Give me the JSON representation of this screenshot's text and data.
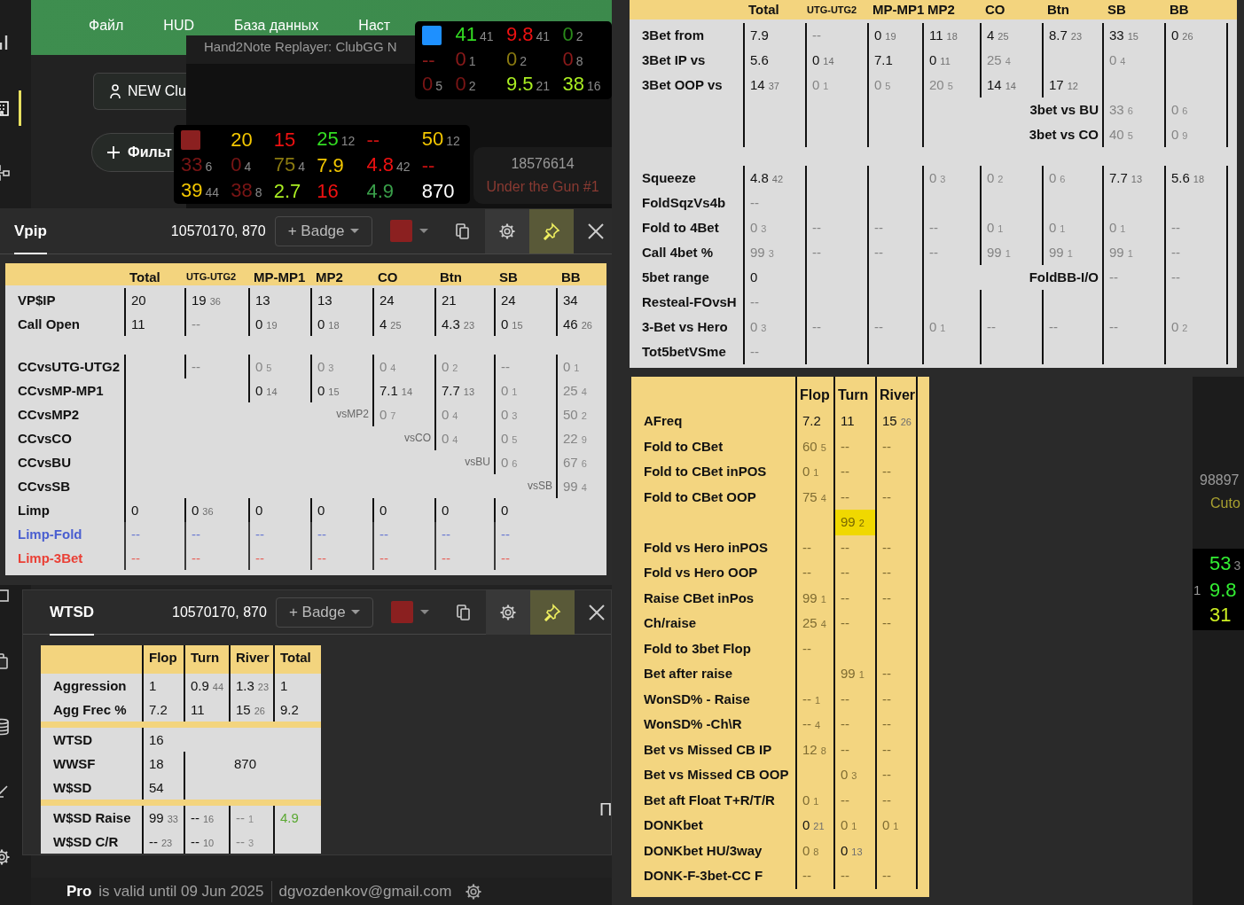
{
  "sidebar": {
    "items": [
      {
        "selected": false
      },
      {
        "selected": true
      },
      {
        "selected": false
      },
      {
        "selected": false
      },
      {
        "selected": false
      },
      {
        "selected": false
      },
      {
        "selected": false
      },
      {
        "selected": false
      }
    ]
  },
  "app_menu": [
    "Файл",
    "HUD",
    "База данных",
    "Наст"
  ],
  "toolbar": {
    "client_button": "NEW Clu",
    "filter_button": "Фильт"
  },
  "replayer": {
    "title": "Hand2Note Replayer: ClubGG N"
  },
  "huds": [
    {
      "rows": [
        [
          {
            "kind": "swatch",
            "color": "#1e90ff"
          },
          {
            "kind": "stat",
            "value": "41",
            "count": "41",
            "color": "#33dd22"
          },
          {
            "kind": "stat",
            "value": "9.8",
            "count": "41",
            "color": "#ee1111"
          },
          {
            "kind": "stat",
            "value": "0",
            "count": "2",
            "color": "#2a8a1a"
          }
        ],
        [
          {
            "kind": "stat",
            "value": "--",
            "color": "#8b1a1a"
          },
          {
            "kind": "stat",
            "value": "0",
            "count": "1",
            "color": "#8b1a1a"
          },
          {
            "kind": "stat",
            "value": "0",
            "count": "2",
            "color": "#8a7a10"
          },
          {
            "kind": "stat",
            "value": "0",
            "count": "8",
            "color": "#8b1a1a"
          }
        ],
        [
          {
            "kind": "stat",
            "value": "0",
            "count": "5",
            "color": "#7a1515"
          },
          {
            "kind": "stat",
            "value": "0",
            "count": "2",
            "color": "#7a1515"
          },
          {
            "kind": "stat",
            "value": "9.5",
            "count": "21",
            "color": "#aaee22"
          },
          {
            "kind": "stat",
            "value": "38",
            "count": "16",
            "color": "#aaee22"
          }
        ]
      ]
    },
    {
      "rows": [
        [
          {
            "kind": "swatch",
            "color": "#8b2020"
          },
          {
            "kind": "stat",
            "value": "20",
            "color": "#f5c800"
          },
          {
            "kind": "stat",
            "value": "15",
            "color": "#ee1111"
          },
          {
            "kind": "stat",
            "value": "25",
            "count": "12",
            "color": "#33dd22"
          },
          {
            "kind": "stat",
            "value": "--",
            "color": "#cc1111"
          },
          {
            "kind": "stat",
            "value": "50",
            "count": "12",
            "color": "#f5c800"
          }
        ],
        [
          {
            "kind": "stat",
            "value": "33",
            "count": "6",
            "color": "#7a1515"
          },
          {
            "kind": "stat",
            "value": "0",
            "count": "4",
            "color": "#7a1515"
          },
          {
            "kind": "stat",
            "value": "75",
            "count": "4",
            "color": "#8a7a10"
          },
          {
            "kind": "stat",
            "value": "7.9",
            "color": "#f5c800"
          },
          {
            "kind": "stat",
            "value": "4.8",
            "count": "42",
            "color": "#ee1111"
          },
          {
            "kind": "stat",
            "value": "--",
            "color": "#cc1111"
          }
        ],
        [
          {
            "kind": "stat",
            "value": "39",
            "count": "44",
            "color": "#f5c800"
          },
          {
            "kind": "stat",
            "value": "38",
            "count": "8",
            "color": "#7a1515"
          },
          {
            "kind": "stat",
            "value": "2.7",
            "color": "#aaee22"
          },
          {
            "kind": "stat",
            "value": "16",
            "color": "#ee1111"
          },
          {
            "kind": "stat",
            "value": "4.9",
            "color": "#3aa04a"
          },
          {
            "kind": "stat",
            "value": "870",
            "color": "#ffffff"
          }
        ]
      ]
    }
  ],
  "player": {
    "id": "18576614",
    "position": "Under the Gun #1"
  },
  "vpip_popup": {
    "tab": {
      "label": "Vpip",
      "selected": true
    },
    "player_ids": "10570170, 870",
    "badge_button": "+ Badge",
    "color": "#8b2020",
    "pinned": true,
    "table": {
      "columns": [
        "Total",
        "UTG-UTG2",
        "MP-MP1",
        "MP2",
        "CO",
        "Btn",
        "SB",
        "BB"
      ],
      "rows": [
        {
          "kind": "stat",
          "label": "VP$IP",
          "cells": [
            {
              "value": "20"
            },
            {
              "value": "19",
              "count": "36"
            },
            {
              "value": "13"
            },
            {
              "value": "13"
            },
            {
              "value": "24"
            },
            {
              "value": "21"
            },
            {
              "value": "24"
            },
            {
              "value": "34"
            }
          ]
        },
        {
          "kind": "stat",
          "label": "Call Open",
          "cells": [
            {
              "value": "11"
            },
            {
              "value": "--",
              "faded": true
            },
            {
              "value": "0",
              "count": "19"
            },
            {
              "value": "0",
              "count": "18"
            },
            {
              "value": "4",
              "count": "25"
            },
            {
              "value": "4.3",
              "count": "23"
            },
            {
              "value": "0",
              "count": "15"
            },
            {
              "value": "46",
              "count": "26"
            }
          ]
        },
        {
          "kind": "spacer"
        },
        {
          "kind": "stat",
          "label": "CCvsUTG-UTG2",
          "cells": [
            {
              "kind": "blank"
            },
            {
              "value": "--",
              "faded": true
            },
            {
              "value": "0",
              "count": "5",
              "faded": true
            },
            {
              "value": "0",
              "count": "3",
              "faded": true
            },
            {
              "value": "0",
              "count": "4",
              "faded": true
            },
            {
              "value": "0",
              "count": "2",
              "faded": true
            },
            {
              "value": "--",
              "faded": true
            },
            {
              "value": "0",
              "count": "1",
              "faded": true
            }
          ]
        },
        {
          "kind": "stat",
          "label": "CCvsMP-MP1",
          "cells": [
            {
              "kind": "blank"
            },
            null,
            {
              "value": "0",
              "count": "14"
            },
            {
              "value": "0",
              "count": "15"
            },
            {
              "value": "7.1",
              "count": "14"
            },
            {
              "value": "7.7",
              "count": "13"
            },
            {
              "value": "0",
              "count": "1",
              "faded": true
            },
            {
              "value": "25",
              "count": "4",
              "faded": true
            }
          ]
        },
        {
          "kind": "stat",
          "label": "CCvsMP2",
          "cells": [
            {
              "kind": "blank"
            },
            null,
            null,
            {
              "kind": "note",
              "value": "vsMP2"
            },
            {
              "value": "0",
              "count": "7",
              "faded": true
            },
            {
              "value": "0",
              "count": "4",
              "faded": true
            },
            {
              "value": "0",
              "count": "3",
              "faded": true
            },
            {
              "value": "50",
              "count": "2",
              "faded": true
            }
          ]
        },
        {
          "kind": "stat",
          "label": "CCvsCO",
          "cells": [
            {
              "kind": "blank"
            },
            null,
            null,
            null,
            {
              "kind": "note",
              "value": "vsCO"
            },
            {
              "value": "0",
              "count": "4",
              "faded": true
            },
            {
              "value": "0",
              "count": "5",
              "faded": true
            },
            {
              "value": "22",
              "count": "9",
              "faded": true
            }
          ]
        },
        {
          "kind": "stat",
          "label": "CCvsBU",
          "cells": [
            {
              "kind": "blank"
            },
            null,
            null,
            null,
            null,
            {
              "kind": "note",
              "value": "vsBU"
            },
            {
              "value": "0",
              "count": "6",
              "faded": true
            },
            {
              "value": "67",
              "count": "6",
              "faded": true
            }
          ]
        },
        {
          "kind": "stat",
          "label": "CCvsSB",
          "cells": [
            {
              "kind": "blank"
            },
            null,
            null,
            null,
            null,
            null,
            {
              "kind": "note",
              "value": "vsSB"
            },
            {
              "value": "99",
              "count": "4",
              "faded": true
            }
          ]
        },
        {
          "kind": "stat",
          "label": "Limp",
          "cells": [
            {
              "value": "0"
            },
            {
              "value": "0",
              "count": "36"
            },
            {
              "value": "0"
            },
            {
              "value": "0"
            },
            {
              "value": "0"
            },
            {
              "value": "0"
            },
            {
              "value": "0"
            },
            null
          ]
        },
        {
          "kind": "stat",
          "label": "Limp-Fold",
          "color": "#4a5fd0",
          "cells": [
            {
              "value": "--",
              "faded": true
            },
            {
              "value": "--",
              "faded": true
            },
            {
              "value": "--",
              "faded": true
            },
            {
              "value": "--",
              "faded": true
            },
            {
              "value": "--",
              "faded": true
            },
            {
              "value": "--",
              "faded": true
            },
            {
              "value": "--",
              "faded": true
            },
            null
          ]
        },
        {
          "kind": "stat",
          "label": "Limp-3Bet",
          "color": "#ea4036",
          "cells": [
            {
              "value": "--",
              "faded": true
            },
            {
              "value": "--",
              "faded": true
            },
            {
              "value": "--",
              "faded": true
            },
            {
              "value": "--",
              "faded": true
            },
            {
              "value": "--",
              "faded": true
            },
            {
              "value": "--",
              "faded": true
            },
            {
              "value": "--",
              "faded": true
            },
            null
          ]
        }
      ]
    }
  },
  "wtsd_popup": {
    "tab": {
      "label": "WTSD",
      "selected": true
    },
    "player_ids": "10570170, 870",
    "badge_button": "+ Badge",
    "color": "#8b2020",
    "pinned": true,
    "table": {
      "columns": [
        "Flop",
        "Turn",
        "River",
        "Total"
      ],
      "rows": [
        {
          "kind": "stat",
          "label": "Aggression",
          "cells": [
            {
              "value": "1"
            },
            {
              "value": "0.9",
              "count": "44"
            },
            {
              "value": "1.3",
              "count": "23"
            },
            {
              "value": "1"
            }
          ]
        },
        {
          "kind": "stat",
          "label": "Agg Frec %",
          "cells": [
            {
              "value": "7.2"
            },
            {
              "value": "11"
            },
            {
              "value": "15",
              "count": "26"
            },
            {
              "value": "9.2"
            }
          ]
        },
        {
          "kind": "divider"
        },
        {
          "kind": "stat",
          "label": "WTSD",
          "cells": [
            {
              "value": "16"
            },
            null,
            null,
            null
          ]
        },
        {
          "kind": "stat",
          "label": "WWSF",
          "cells": [
            {
              "value": "18"
            },
            {
              "kind": "blank"
            },
            {
              "kind": "free",
              "value": "870"
            },
            null
          ]
        },
        {
          "kind": "stat",
          "label": "W$SD",
          "cells": [
            {
              "value": "54"
            },
            {
              "kind": "blank"
            },
            null,
            null
          ]
        },
        {
          "kind": "divider"
        },
        {
          "kind": "stat",
          "label": "W$SD Raise",
          "cells": [
            {
              "value": "99",
              "count": "33"
            },
            {
              "value": "--",
              "count": "16"
            },
            {
              "value": "--",
              "count": "1",
              "faded": true
            },
            {
              "value": "4.9",
              "color": "#5aa832"
            }
          ]
        },
        {
          "kind": "stat",
          "label": "W$SD C/R",
          "cells": [
            {
              "value": "--",
              "count": "23"
            },
            {
              "value": "--",
              "count": "10"
            },
            {
              "value": "--",
              "count": "3",
              "faded": true
            },
            {
              "kind": "blank"
            }
          ]
        }
      ]
    }
  },
  "footer": {
    "plan": "Pro",
    "validity": "is valid until 09 Jun 2025",
    "email": "dgvozdenkov@gmail.com"
  },
  "cut_glyph": "П",
  "preflop_table": {
    "columns": [
      "Total",
      "UTG-UTG2",
      "MP-MP1",
      "MP2",
      "CO",
      "Btn",
      "SB",
      "BB"
    ],
    "rows": [
      {
        "kind": "stat",
        "label": "3Bet from",
        "cells": [
          {
            "value": "7.9"
          },
          {
            "value": "--",
            "faded": true
          },
          {
            "value": "0",
            "count": "19"
          },
          {
            "value": "11",
            "count": "18"
          },
          {
            "value": "4",
            "count": "25"
          },
          {
            "value": "8.7",
            "count": "23"
          },
          {
            "value": "33",
            "count": "15"
          },
          {
            "value": "0",
            "count": "26"
          }
        ]
      },
      {
        "kind": "stat",
        "label": "3Bet IP vs",
        "cells": [
          {
            "value": "5.6"
          },
          {
            "value": "0",
            "count": "14"
          },
          {
            "value": "7.1"
          },
          {
            "value": "0",
            "count": "11"
          },
          {
            "value": "25",
            "count": "4",
            "faded": true
          },
          {
            "kind": "blank"
          },
          {
            "value": "0",
            "count": "4",
            "faded": true
          },
          {
            "kind": "blank"
          }
        ]
      },
      {
        "kind": "stat",
        "label": "3Bet OOP vs",
        "cells": [
          {
            "value": "14",
            "count": "37"
          },
          {
            "value": "0",
            "count": "1",
            "faded": true
          },
          {
            "value": "0",
            "count": "5",
            "faded": true
          },
          {
            "value": "20",
            "count": "5",
            "faded": true
          },
          {
            "value": "14",
            "count": "14"
          },
          {
            "value": "17",
            "count": "12"
          },
          {
            "kind": "blank"
          },
          {
            "kind": "blank"
          }
        ]
      },
      {
        "kind": "stat",
        "cells": [
          {
            "kind": "blank"
          },
          {
            "kind": "blank"
          },
          {
            "kind": "blank"
          },
          {
            "kind": "blank"
          },
          {
            "kind": "wide-label",
            "value": "3bet vs BU"
          },
          {
            "value": "33",
            "count": "6",
            "faded": true
          },
          {
            "value": "0",
            "count": "6",
            "faded": true
          }
        ]
      },
      {
        "kind": "stat",
        "cells": [
          {
            "kind": "blank"
          },
          {
            "kind": "blank"
          },
          {
            "kind": "blank"
          },
          {
            "kind": "blank"
          },
          {
            "kind": "wide-label",
            "value": "3bet vs CO"
          },
          {
            "value": "40",
            "count": "5",
            "faded": true
          },
          {
            "value": "0",
            "count": "9",
            "faded": true
          }
        ]
      },
      {
        "kind": "spacer"
      },
      {
        "kind": "stat",
        "label": "Squeeze",
        "cells": [
          {
            "value": "4.8",
            "count": "42"
          },
          {
            "kind": "blank"
          },
          {
            "kind": "blank"
          },
          {
            "value": "0",
            "count": "3",
            "faded": true
          },
          {
            "value": "0",
            "count": "2",
            "faded": true
          },
          {
            "value": "0",
            "count": "6",
            "faded": true
          },
          {
            "value": "7.7",
            "count": "13"
          },
          {
            "value": "5.6",
            "count": "18"
          }
        ]
      },
      {
        "kind": "stat",
        "label": "FoldSqzVs4b",
        "cells": [
          {
            "value": "--",
            "faded": true
          },
          {
            "kind": "blank"
          },
          {
            "kind": "blank"
          },
          {
            "kind": "blank"
          },
          {
            "kind": "blank"
          },
          {
            "kind": "blank"
          },
          {
            "kind": "blank"
          },
          {
            "kind": "blank"
          }
        ]
      },
      {
        "kind": "stat",
        "label": "Fold to 4Bet",
        "cells": [
          {
            "value": "0",
            "count": "3",
            "faded": true
          },
          {
            "value": "--",
            "faded": true
          },
          {
            "value": "--",
            "faded": true
          },
          {
            "value": "--",
            "faded": true
          },
          {
            "value": "0",
            "count": "1",
            "faded": true
          },
          {
            "value": "0",
            "count": "1",
            "faded": true
          },
          {
            "value": "0",
            "count": "1",
            "faded": true
          },
          {
            "value": "--",
            "faded": true
          }
        ]
      },
      {
        "kind": "stat",
        "label": "Call 4bet %",
        "cells": [
          {
            "value": "99",
            "count": "3",
            "faded": true
          },
          {
            "value": "--",
            "faded": true
          },
          {
            "value": "--",
            "faded": true
          },
          {
            "value": "--",
            "faded": true
          },
          {
            "value": "99",
            "count": "1",
            "faded": true
          },
          {
            "value": "99",
            "count": "1",
            "faded": true
          },
          {
            "value": "99",
            "count": "1",
            "faded": true
          },
          {
            "value": "--",
            "faded": true
          }
        ]
      },
      {
        "kind": "stat",
        "label": "5bet range",
        "cells": [
          {
            "value": "0"
          },
          {
            "kind": "blank"
          },
          {
            "kind": "blank"
          },
          {
            "kind": "blank"
          },
          {
            "kind": "wide-label",
            "value": "FoldBB-I/O"
          },
          {
            "value": "--",
            "faded": true
          },
          {
            "value": "--",
            "faded": true
          }
        ]
      },
      {
        "kind": "stat",
        "label": "Resteal-FOvsH",
        "cells": [
          {
            "value": "--",
            "faded": true
          },
          {
            "kind": "blank"
          },
          {
            "kind": "blank"
          },
          {
            "kind": "blank"
          },
          {
            "kind": "blank"
          },
          {
            "kind": "blank"
          },
          {
            "kind": "blank"
          },
          {
            "kind": "blank"
          }
        ]
      },
      {
        "kind": "stat",
        "label": "3-Bet vs Hero",
        "cells": [
          {
            "value": "0",
            "count": "3",
            "faded": true
          },
          {
            "value": "--",
            "faded": true
          },
          {
            "value": "--",
            "faded": true
          },
          {
            "value": "0",
            "count": "1",
            "faded": true
          },
          {
            "value": "--",
            "faded": true
          },
          {
            "value": "--",
            "faded": true
          },
          {
            "value": "--",
            "faded": true
          },
          {
            "value": "0",
            "count": "2",
            "faded": true
          }
        ]
      },
      {
        "kind": "stat",
        "label": "Tot5betVSme",
        "cells": [
          {
            "value": "--",
            "faded": true
          },
          {
            "kind": "blank"
          },
          {
            "kind": "blank"
          },
          {
            "kind": "blank"
          },
          {
            "kind": "blank"
          },
          {
            "kind": "blank"
          },
          {
            "kind": "blank"
          },
          {
            "kind": "blank"
          }
        ]
      }
    ]
  },
  "postflop_table": {
    "columns": [
      "Flop",
      "Turn",
      "River"
    ],
    "rows": [
      {
        "kind": "stat",
        "label": "AFreq",
        "cells": [
          {
            "value": "7.2"
          },
          {
            "value": "11"
          },
          {
            "value": "15",
            "count": "26"
          }
        ]
      },
      {
        "kind": "stat",
        "label": "Fold to CBet",
        "cells": [
          {
            "value": "60",
            "count": "5",
            "faded": true
          },
          {
            "value": "--",
            "faded": true
          },
          {
            "value": "--",
            "faded": true
          }
        ]
      },
      {
        "kind": "stat",
        "label": "Fold to CBet inPOS",
        "cells": [
          {
            "value": "0",
            "count": "1",
            "faded": true
          },
          {
            "value": "--",
            "faded": true
          },
          {
            "value": "--",
            "faded": true
          }
        ]
      },
      {
        "kind": "stat",
        "label": "Fold to CBet OOP",
        "cells": [
          {
            "value": "75",
            "count": "4",
            "faded": true
          },
          {
            "value": "--",
            "faded": true
          },
          {
            "value": "--",
            "faded": true
          }
        ]
      },
      {
        "kind": "stat",
        "cells": [
          {
            "kind": "blank"
          },
          {
            "value": "99",
            "count": "2",
            "highlighted": true
          },
          {
            "kind": "blank"
          }
        ]
      },
      {
        "kind": "stat",
        "label": "Fold vs Hero inPOS",
        "cells": [
          {
            "value": "--",
            "faded": true
          },
          {
            "value": "--",
            "faded": true
          },
          {
            "value": "--",
            "faded": true
          }
        ]
      },
      {
        "kind": "stat",
        "label": "Fold vs Hero OOP",
        "cells": [
          {
            "value": "--",
            "faded": true
          },
          {
            "value": "--",
            "faded": true
          },
          {
            "value": "--",
            "faded": true
          }
        ]
      },
      {
        "kind": "stat",
        "label": "Raise CBet inPos",
        "cells": [
          {
            "value": "99",
            "count": "1",
            "faded": true
          },
          {
            "value": "--",
            "faded": true
          },
          {
            "value": "--",
            "faded": true
          }
        ]
      },
      {
        "kind": "stat",
        "label": "Ch/raise",
        "cells": [
          {
            "value": "25",
            "count": "4",
            "faded": true
          },
          {
            "value": "--",
            "faded": true
          },
          {
            "value": "--",
            "faded": true
          }
        ]
      },
      {
        "kind": "stat",
        "label": "Fold to 3bet Flop",
        "cells": [
          {
            "value": "--",
            "faded": true
          },
          {
            "kind": "blank"
          },
          {
            "kind": "blank"
          }
        ]
      },
      {
        "kind": "stat",
        "label": "Bet after raise",
        "cells": [
          {
            "kind": "blank"
          },
          {
            "value": "99",
            "count": "1",
            "faded": true
          },
          {
            "value": "--",
            "faded": true
          }
        ]
      },
      {
        "kind": "stat",
        "label": "WonSD% - Raise",
        "cells": [
          {
            "value": "--",
            "count": "1",
            "faded": true
          },
          {
            "value": "--",
            "faded": true
          },
          {
            "value": "--",
            "faded": true
          }
        ]
      },
      {
        "kind": "stat",
        "label": "WonSD% -Ch\\R",
        "cells": [
          {
            "value": "--",
            "count": "4",
            "faded": true
          },
          {
            "value": "--",
            "faded": true
          },
          {
            "value": "--",
            "faded": true
          }
        ]
      },
      {
        "kind": "stat",
        "label": "Bet vs Missed CB IP",
        "cells": [
          {
            "value": "12",
            "count": "8",
            "faded": true
          },
          {
            "value": "--",
            "faded": true
          },
          {
            "value": "--",
            "faded": true
          }
        ]
      },
      {
        "kind": "stat",
        "label": "Bet vs Missed CB OOP",
        "cells": [
          {
            "kind": "blank"
          },
          {
            "value": "0",
            "count": "3",
            "faded": true
          },
          {
            "value": "--",
            "faded": true
          }
        ]
      },
      {
        "kind": "stat",
        "label": "Bet aft Float T+R/T/R",
        "cells": [
          {
            "value": "0",
            "count": "1",
            "faded": true
          },
          {
            "value": "--",
            "faded": true
          },
          {
            "value": "--",
            "faded": true
          }
        ]
      },
      {
        "kind": "stat",
        "label": "DONKbet",
        "cells": [
          {
            "value": "0",
            "count": "21"
          },
          {
            "value": "0",
            "count": "1",
            "faded": true
          },
          {
            "value": "0",
            "count": "1",
            "faded": true
          }
        ]
      },
      {
        "kind": "stat",
        "label": "DONKbet HU/3way",
        "cells": [
          {
            "value": "0",
            "count": "8",
            "faded": true
          },
          {
            "value": "0",
            "count": "13"
          },
          {
            "kind": "blank"
          }
        ]
      },
      {
        "kind": "stat",
        "label": "DONK-F-3bet-CC F",
        "cells": [
          {
            "value": "--",
            "faded": true
          },
          {
            "value": "--",
            "faded": true
          },
          {
            "value": "--",
            "faded": true
          }
        ]
      }
    ]
  },
  "side_player": {
    "id": "98897",
    "position": "Cuto",
    "cut_count": "1",
    "stats": [
      {
        "value": "53",
        "count": "3",
        "color": "#33ee33"
      },
      {
        "value": "9.8",
        "color": "#33ee33"
      },
      {
        "value": "31",
        "color": "#ccee22"
      }
    ]
  }
}
